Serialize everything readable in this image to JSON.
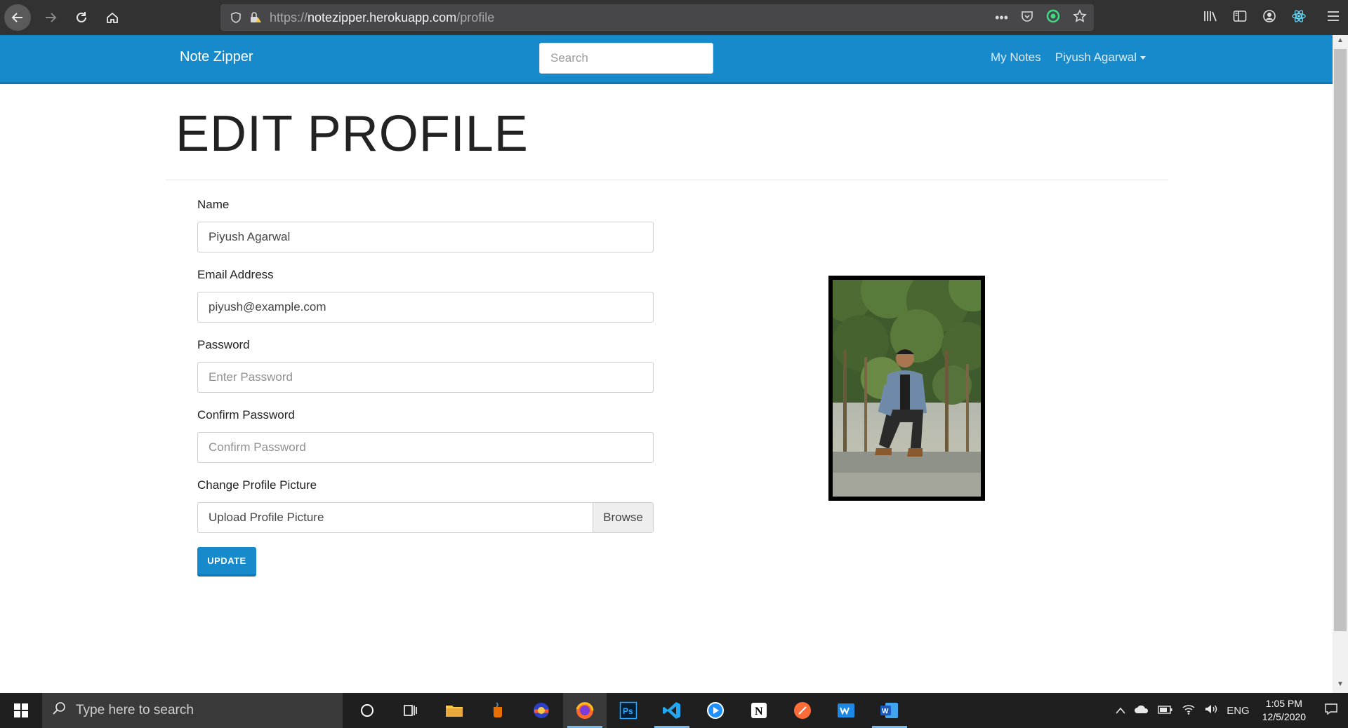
{
  "browser": {
    "url_scheme": "https://",
    "url_host": "notezipper.herokuapp.com",
    "url_path": "/profile"
  },
  "navbar": {
    "brand": "Note Zipper",
    "search_placeholder": "Search",
    "my_notes": "My Notes",
    "user_menu": "Piyush Agarwal",
    "bg_color": "#178acc"
  },
  "page": {
    "title": "EDIT PROFILE"
  },
  "form": {
    "name_label": "Name",
    "name_value": "Piyush Agarwal",
    "email_label": "Email Address",
    "email_value": "piyush@example.com",
    "password_label": "Password",
    "password_placeholder": "Enter Password",
    "confirm_label": "Confirm Password",
    "confirm_placeholder": "Confirm Password",
    "picture_label": "Change Profile Picture",
    "picture_placeholder": "Upload Profile Picture",
    "browse_label": "Browse",
    "update_label": "UPDATE"
  },
  "taskbar": {
    "search_placeholder": "Type here to search",
    "language": "ENG",
    "time": "1:05 PM",
    "date": "12/5/2020"
  }
}
